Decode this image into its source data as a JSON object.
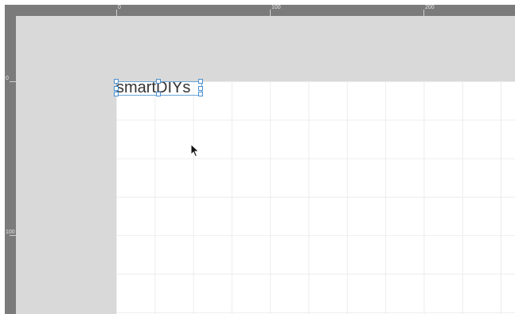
{
  "rulers": {
    "top_labels": [
      "0",
      "100",
      "200"
    ],
    "left_labels": [
      "0",
      "100"
    ]
  },
  "artboard": {
    "text_object": "smartDIYs"
  },
  "colors": {
    "ruler": "#7b7b7b",
    "pasteboard": "#d9d9d9",
    "artboard": "#ffffff",
    "selection": "#4a8fd0"
  },
  "icons": {
    "cursor": "mouse-pointer-icon"
  }
}
